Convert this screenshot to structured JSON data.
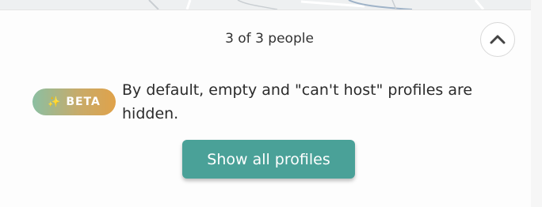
{
  "results": {
    "count_text": "3 of 3 people"
  },
  "collapse_button": {
    "icon": "chevron-up-icon"
  },
  "notice": {
    "badge_label": "BETA",
    "badge_icon": "sparkle-icon",
    "text": "By default, empty and \"can't host\" profiles are hidden."
  },
  "actions": {
    "show_all_label": "Show all profiles"
  },
  "colors": {
    "button_bg": "#4aa198",
    "badge_gradient_start": "#8bbfa2",
    "badge_gradient_end": "#e0a24a"
  }
}
